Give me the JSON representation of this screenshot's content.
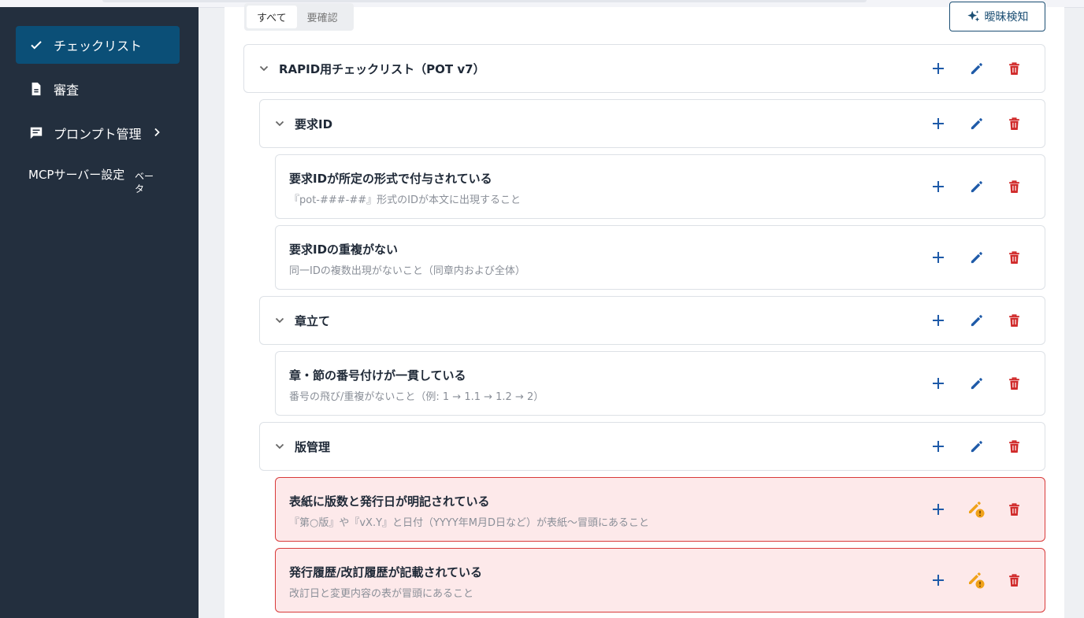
{
  "sidebar": {
    "items": [
      {
        "label": "チェックリスト",
        "icon": "check-icon"
      },
      {
        "label": "審査",
        "icon": "document-icon"
      },
      {
        "label": "プロンプト管理",
        "icon": "prompt-icon"
      }
    ],
    "mcp": {
      "label": "MCPサーバー設定",
      "badge": "ベータ"
    }
  },
  "toolbar": {
    "filters": [
      "すべて",
      "要確認"
    ],
    "ambiguity_label": "曖昧検知"
  },
  "tree": {
    "root": {
      "title": "RAPID用チェックリスト（POT v7）"
    },
    "groups": [
      {
        "title": "要求ID"
      },
      {
        "title": "章立て"
      },
      {
        "title": "版管理"
      }
    ],
    "items": [
      {
        "title": "要求IDが所定の形式で付与されている",
        "desc": "『pot-###-##』形式のIDが本文に出現すること"
      },
      {
        "title": "要求IDの重複がない",
        "desc": "同一IDの複数出現がないこと（同章内および全体）"
      },
      {
        "title": "章・節の番号付けが一貫している",
        "desc": "番号の飛び/重複がないこと（例: 1 → 1.1 → 1.2 → 2）"
      },
      {
        "title": "表紙に版数と発行日が明記されている",
        "desc": "『第○版』や『vX.Y』と日付（YYYY年M月D日など）が表紙〜冒頭にあること"
      },
      {
        "title": "発行履歴/改訂履歴が記載されている",
        "desc": "改訂日と変更内容の表が冒頭にあること"
      }
    ]
  },
  "colors": {
    "sidebar": "#232f3e",
    "active": "#0b4f77",
    "add": "#1e5aa8",
    "edit": "#1e5aa8",
    "delete": "#d02828",
    "warn": "#f0a21a",
    "warn_bg": "#fde9ea",
    "warn_border": "#d83a3a"
  }
}
